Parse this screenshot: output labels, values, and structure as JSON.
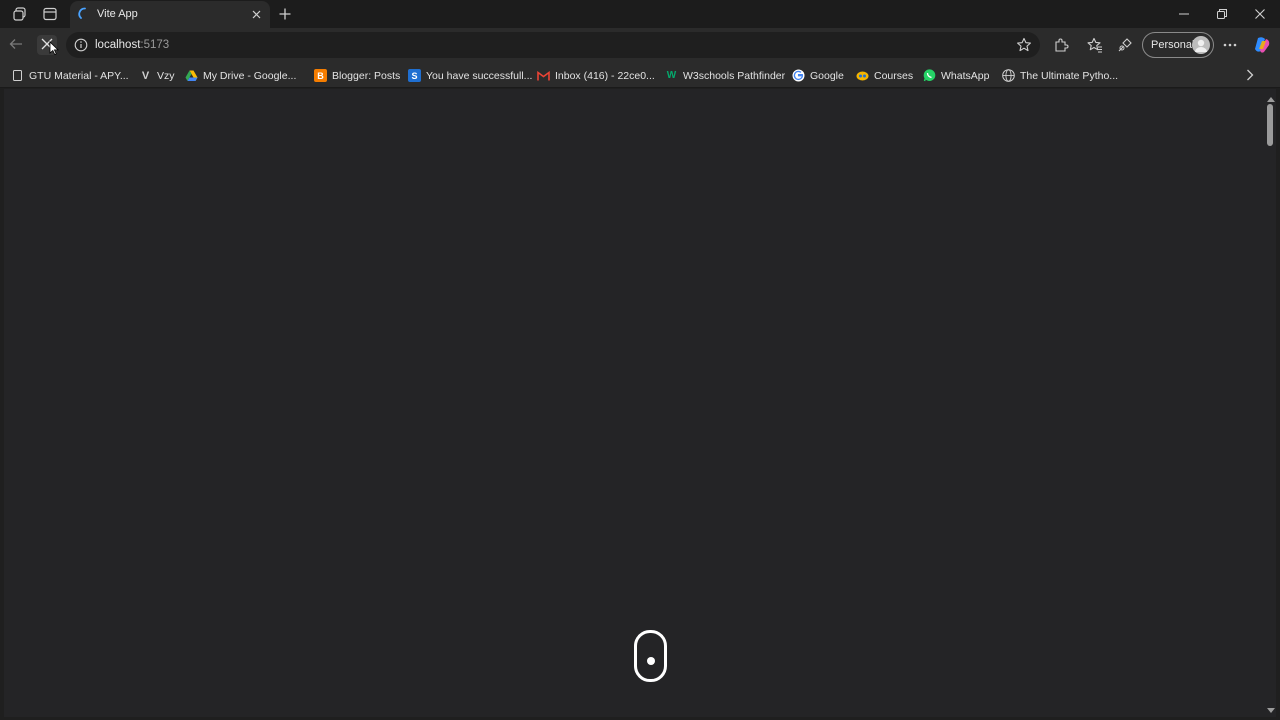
{
  "tab": {
    "title": "Vite App"
  },
  "address_bar": {
    "host": "localhost",
    "port": ":5173"
  },
  "profile": {
    "label": "Personal"
  },
  "bookmarks": [
    {
      "label": "GTU Material - APY...",
      "icon": "page-icon"
    },
    {
      "label": "Vzy",
      "icon": "v-icon"
    },
    {
      "label": "My Drive - Google...",
      "icon": "drive-icon"
    },
    {
      "label": "Blogger: Posts",
      "icon": "blogger-icon"
    },
    {
      "label": "You have successfull...",
      "icon": "s-icon"
    },
    {
      "label": "Inbox (416) - 22ce0...",
      "icon": "gmail-icon"
    },
    {
      "label": "W3schools Pathfinder",
      "icon": "w3-icon"
    },
    {
      "label": "Google",
      "icon": "google-icon"
    },
    {
      "label": "Courses",
      "icon": "courses-icon"
    },
    {
      "label": "WhatsApp",
      "icon": "whatsapp-icon"
    },
    {
      "label": "The Ultimate Pytho...",
      "icon": "globe-icon"
    }
  ],
  "colors": {
    "tab_bg": "#2b2b2b",
    "page_bg": "#242426",
    "blogger": "#f57d00",
    "s_blue": "#1f6fd1",
    "whatsapp": "#25d366"
  }
}
